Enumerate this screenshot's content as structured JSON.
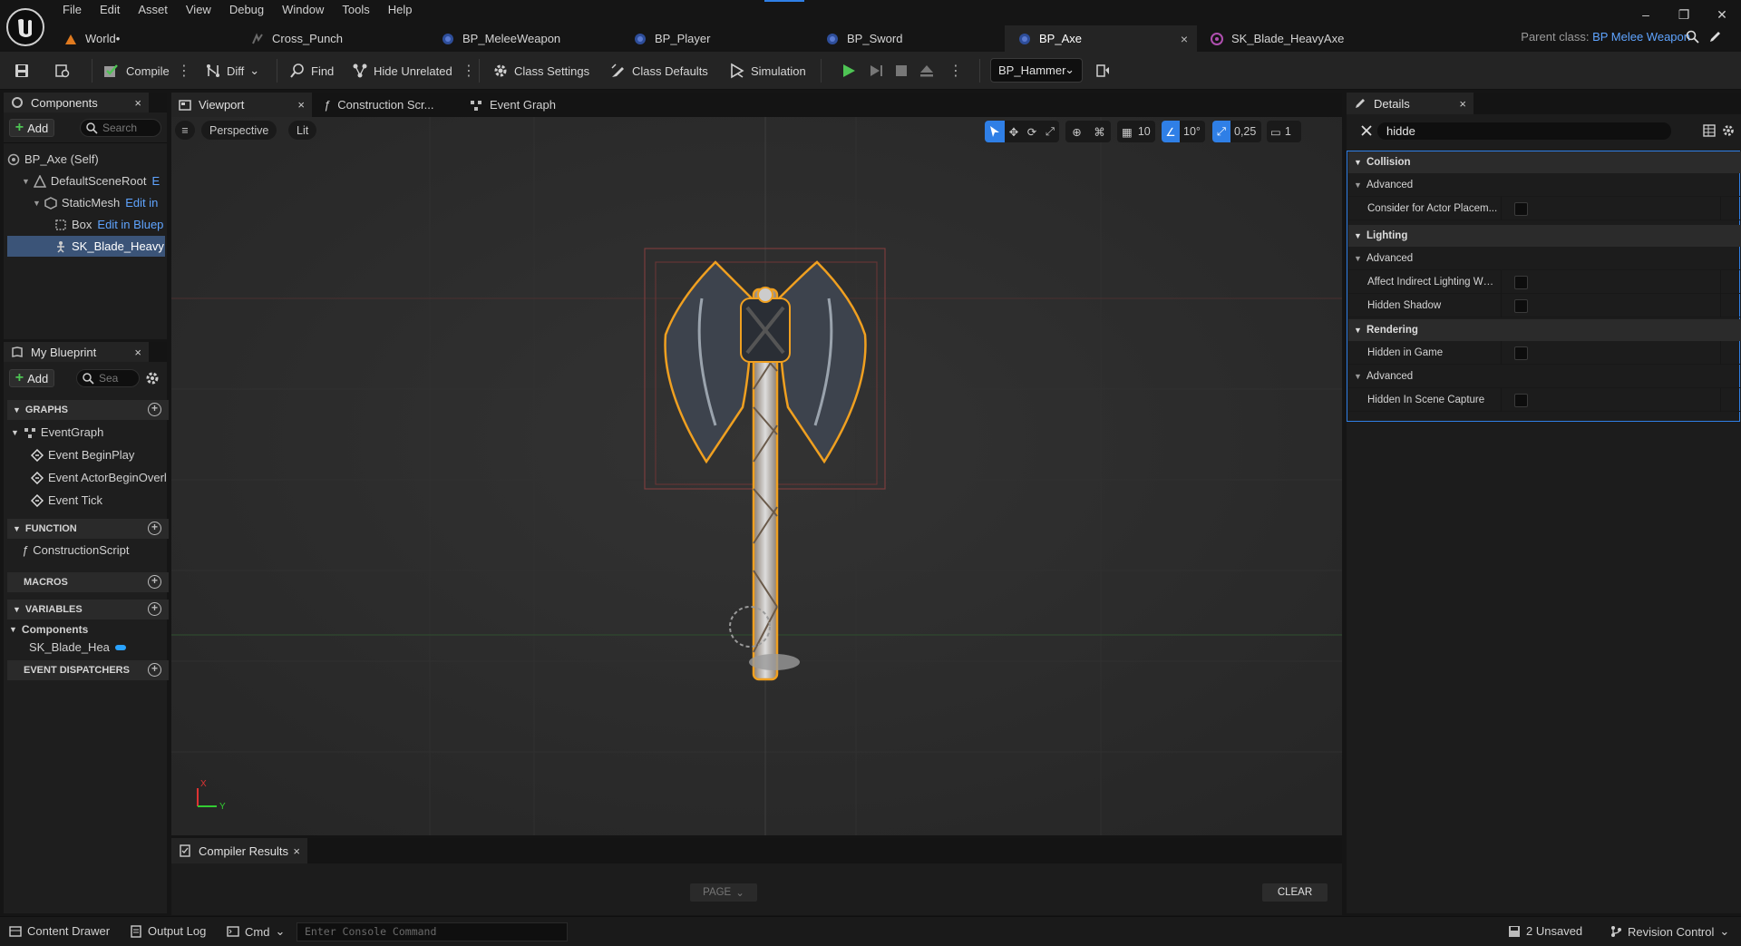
{
  "app": {
    "menu": [
      "File",
      "Edit",
      "Asset",
      "View",
      "Debug",
      "Window",
      "Tools",
      "Help"
    ],
    "tabs": [
      {
        "label": "World•",
        "icon": "level-icon"
      },
      {
        "label": "Cross_Punch",
        "icon": "animation-icon"
      },
      {
        "label": "BP_MeleeWeapon",
        "icon": "blueprint-icon"
      },
      {
        "label": "BP_Player",
        "icon": "blueprint-icon"
      },
      {
        "label": "BP_Sword",
        "icon": "blueprint-icon"
      },
      {
        "label": "BP_Axe",
        "icon": "blueprint-icon",
        "close": "×"
      },
      {
        "label": "SK_Blade_HeavyAxe",
        "icon": "skeletal-mesh-icon"
      }
    ],
    "parent_class_label": "Parent class:",
    "parent_class_value": "BP Melee Weapon",
    "window_controls": {
      "minimize": "–",
      "restore": "❐",
      "close": "✕"
    }
  },
  "toolbar": {
    "compile": "Compile",
    "diff": "Diff",
    "find": "Find",
    "hide_unrelated": "Hide Unrelated",
    "class_settings": "Class Settings",
    "class_defaults": "Class Defaults",
    "simulation": "Simulation",
    "debug_object": "BP_Hammer"
  },
  "components_panel": {
    "title": "Components",
    "close": "×",
    "add_label": "Add",
    "search_placeholder": "Search",
    "tree": [
      {
        "label": "BP_Axe (Self)",
        "link": ""
      },
      {
        "label": "DefaultSceneRoot",
        "link": "E"
      },
      {
        "label": "StaticMesh",
        "link": "Edit in"
      },
      {
        "label": "Box",
        "link": "Edit in Bluep"
      },
      {
        "label": "SK_Blade_Heavy",
        "link": ""
      }
    ]
  },
  "my_blueprint": {
    "title": "My Blueprint",
    "close": "×",
    "add_label": "Add",
    "search_placeholder": "Sea",
    "graphs_header": "GRAPHS",
    "event_graph": "EventGraph",
    "events": [
      "Event BeginPlay",
      "Event ActorBeginOverl",
      "Event Tick"
    ],
    "function_header": "FUNCTION",
    "construction_script": "ConstructionScript",
    "macros_header": "MACROS",
    "variables_header": "VARIABLES",
    "components_group": "Components",
    "component_var": "SK_Blade_Hea",
    "event_dispatchers_header": "EVENT DISPATCHERS"
  },
  "editor_tabs": {
    "viewport": "Viewport",
    "viewport_close": "×",
    "construction": "Construction Scr...",
    "event_graph": "Event Graph"
  },
  "viewport": {
    "perspective": "Perspective",
    "lit": "Lit",
    "grid_snap": "10",
    "rotation_snap": "10°",
    "scale_snap": "0,25",
    "camera_speed": "1",
    "axis_x": "X",
    "axis_y": "Y"
  },
  "details": {
    "title": "Details",
    "close": "×",
    "search_value": "hidde",
    "categories": {
      "collision": "Collision",
      "lighting": "Lighting",
      "rendering": "Rendering"
    },
    "advanced": "Advanced",
    "rows": {
      "consider_actor": "Consider for Actor Placem...",
      "affect_indirect": "Affect Indirect Lighting Whi...",
      "hidden_shadow": "Hidden Shadow",
      "hidden_in_game": "Hidden in Game",
      "hidden_scene_capture": "Hidden In Scene Capture"
    }
  },
  "compiler": {
    "title": "Compiler Results",
    "close": "×",
    "page": "PAGE",
    "clear": "CLEAR"
  },
  "statusbar": {
    "content_drawer": "Content Drawer",
    "output_log": "Output Log",
    "cmd": "Cmd",
    "console_placeholder": "Enter Console Command",
    "unsaved": "2 Unsaved",
    "revision_control": "Revision Control"
  },
  "colors": {
    "accent_blue": "#2f7fe6",
    "link_blue": "#5fa4ff",
    "selection": "#3b5478",
    "play_green": "#4ec454",
    "selection_outline": "#f0a020"
  }
}
